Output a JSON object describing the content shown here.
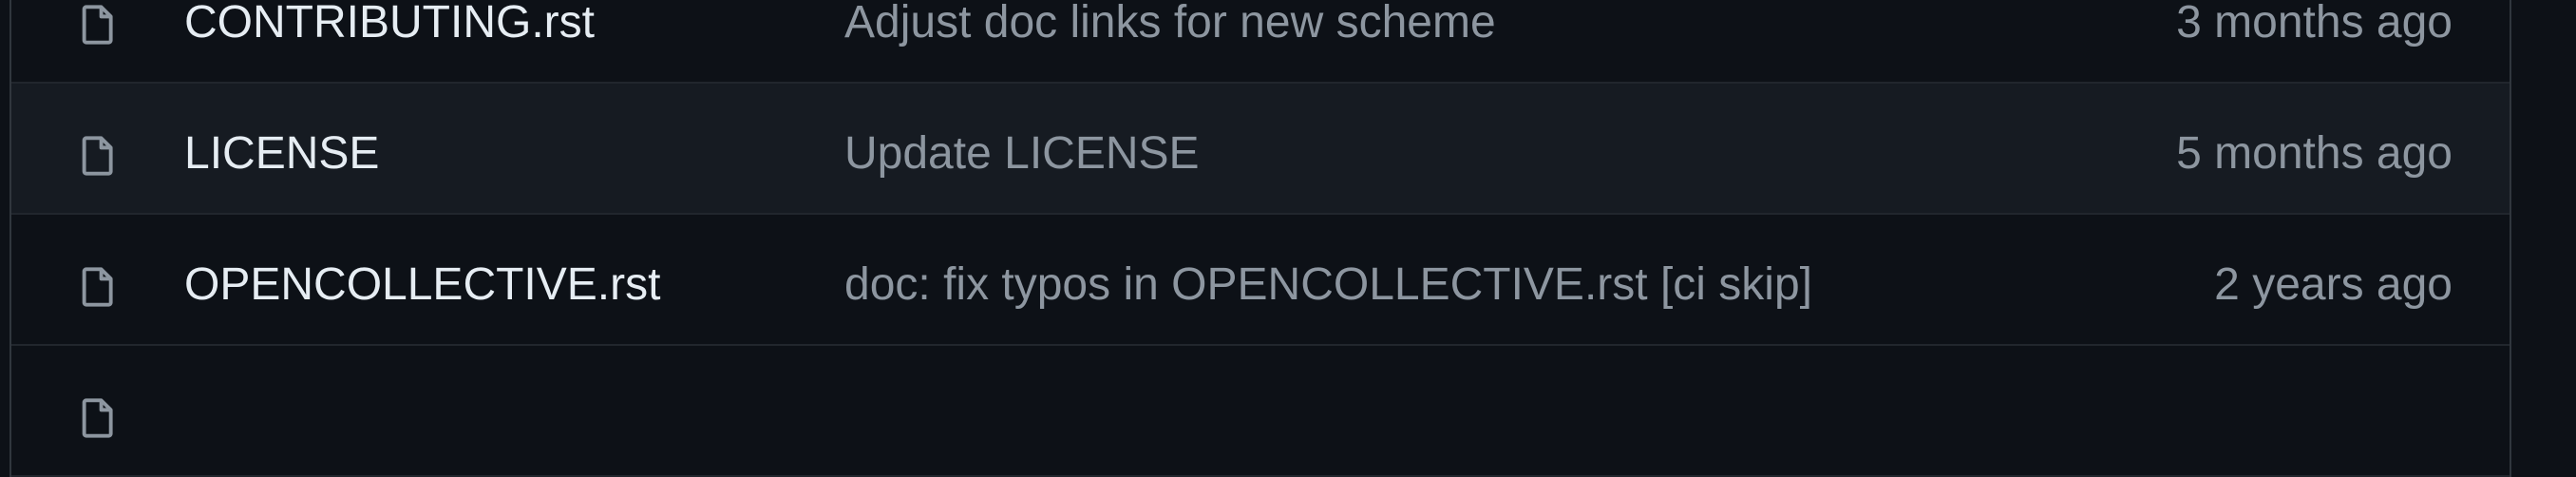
{
  "file_list": {
    "rows": [
      {
        "icon": "file-icon",
        "name": "CONTRIBUTING.rst",
        "commit_message": "Adjust doc links for new scheme",
        "age": "3 months ago",
        "hover": false
      },
      {
        "icon": "file-icon",
        "name": "LICENSE",
        "commit_message": "Update LICENSE",
        "age": "5 months ago",
        "hover": true
      },
      {
        "icon": "file-icon",
        "name": "OPENCOLLECTIVE.rst",
        "commit_message": "doc: fix typos in OPENCOLLECTIVE.rst [ci skip]",
        "age": "2 years ago",
        "hover": false
      },
      {
        "icon": "file-icon",
        "name": "",
        "commit_message": "",
        "age": "",
        "hover": false
      }
    ]
  },
  "colors": {
    "background": "#0d1117",
    "row_hover": "#161b22",
    "file_name": "#e6edf3",
    "muted_text": "#8d96a0",
    "icon": "#8d96a0",
    "border": "#30363d"
  }
}
